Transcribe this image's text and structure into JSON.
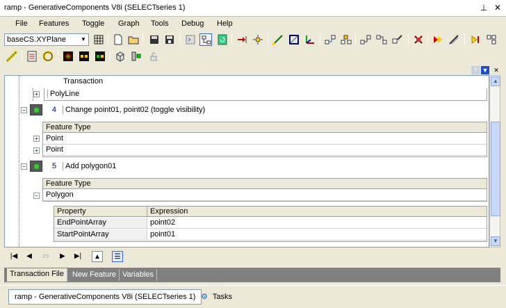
{
  "window": {
    "title": "ramp - GenerativeComponents V8i (SELECTseries 1)"
  },
  "menu": [
    "File",
    "Features",
    "Toggle",
    "Graph",
    "Tools",
    "Debug",
    "Help"
  ],
  "toolbar": {
    "combo_value": "baseCS.XYPlane",
    "icons_row1": [
      "grid-icon",
      "new-file-icon",
      "open-folder-icon",
      "save-icon",
      "save-all-icon",
      "script-icon",
      "graph-layout-icon",
      "refresh-icon",
      "step-in-icon",
      "sun-icon",
      "line-tool-icon",
      "square-tool-icon",
      "axes-icon",
      "node-a-icon",
      "node-b-icon",
      "node-c-icon",
      "node-d-icon",
      "wrench-icon",
      "stop-icon",
      "play-forward-icon",
      "pen-icon",
      "play-back-icon",
      "grid-small-icon"
    ],
    "icons_row2": [
      "ruler-icon",
      "list-icon",
      "ring-icon",
      "diamond-icon",
      "cells-icon",
      "cells-green-icon",
      "cube-icon",
      "puzzle-icon",
      "lock-icon"
    ]
  },
  "transactions": {
    "column_header": "Transaction",
    "polyline_label": "PolyLine",
    "items": [
      {
        "number": "4",
        "label": "Change point01, point02 (toggle visibility)"
      },
      {
        "number": "5",
        "label": "Add polygon01"
      }
    ],
    "feature_type_header": "Feature Type",
    "tx4_features": [
      "Point",
      "Point"
    ],
    "tx5_features": [
      "Polygon"
    ],
    "property_table": {
      "headers": [
        "Property",
        "Expression"
      ],
      "rows": [
        {
          "property": "EndPointArray",
          "expression": "point02"
        },
        {
          "property": "StartPointArray",
          "expression": "point01"
        }
      ]
    }
  },
  "tabs": [
    "Transaction File",
    "New Feature",
    "Variables"
  ],
  "active_tab": "Transaction File",
  "taskbar": {
    "items": [
      "ramp - GenerativeComponents V8i (SELECTseries 1)",
      "Tasks"
    ]
  },
  "colors": {
    "active_indicator": "#22dd22",
    "link_blue": "#316ac5"
  }
}
